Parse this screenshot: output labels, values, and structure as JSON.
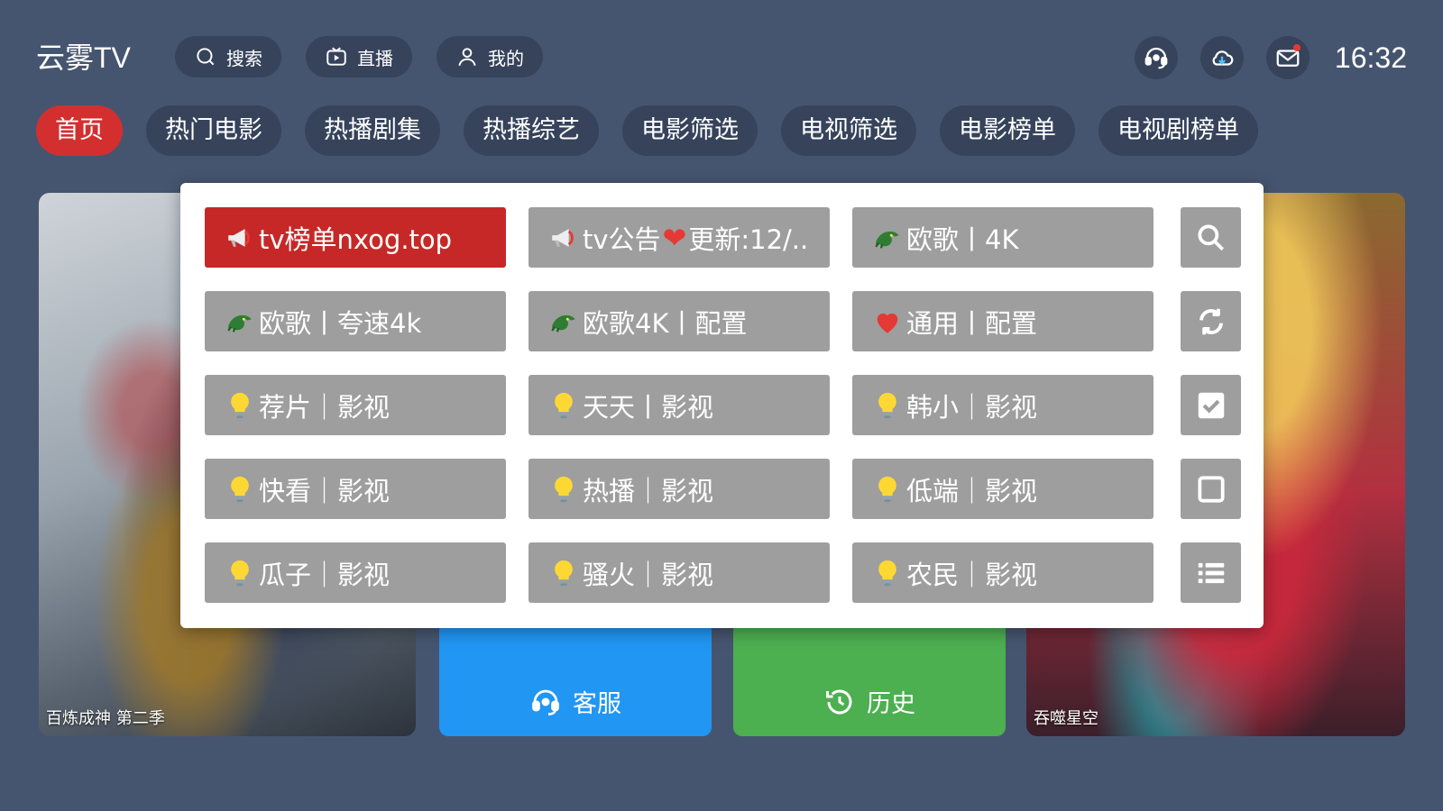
{
  "header": {
    "app_title": "云雾TV",
    "pills": [
      {
        "label": "搜索",
        "icon": "search-icon"
      },
      {
        "label": "直播",
        "icon": "live-tv-icon"
      },
      {
        "label": "我的",
        "icon": "user-icon"
      }
    ],
    "round_buttons": [
      "headset-icon",
      "cloud-icon",
      "mail-icon"
    ],
    "clock": "16:32"
  },
  "tabs": [
    "首页",
    "热门电影",
    "热播剧集",
    "热播综艺",
    "电影筛选",
    "电视筛选",
    "电影榜单",
    "电视剧榜单"
  ],
  "active_tab": "首页",
  "posters": {
    "left_caption": "百炼成神 第二季",
    "right_caption": "吞噬星空"
  },
  "actions": {
    "service_label": "客服",
    "history_label": "历史"
  },
  "source_panel": {
    "rows": [
      [
        {
          "label": "tv榜单nxog.top",
          "icon": "megaphone-icon",
          "active": true
        },
        {
          "label": "tv公告",
          "heart": "❤",
          "suffix": "更新:12/..",
          "icon": "megaphone-icon"
        },
        {
          "label": "欧歌丨4K",
          "icon": "dragon-icon"
        }
      ],
      [
        {
          "label": "欧歌丨夸速4k",
          "icon": "dragon-icon"
        },
        {
          "label": "欧歌4K丨配置",
          "icon": "dragon-icon"
        },
        {
          "label": "通用丨配置",
          "icon": "heart-icon"
        }
      ],
      [
        {
          "label": "荐片｜影视",
          "icon": "bulb-icon"
        },
        {
          "label": "天天丨影视",
          "icon": "bulb-icon"
        },
        {
          "label": "韩小｜影视",
          "icon": "bulb-icon"
        }
      ],
      [
        {
          "label": "快看｜影视",
          "icon": "bulb-icon"
        },
        {
          "label": "热播｜影视",
          "icon": "bulb-icon"
        },
        {
          "label": "低端｜影视",
          "icon": "bulb-icon"
        }
      ],
      [
        {
          "label": "瓜子｜影视",
          "icon": "bulb-icon"
        },
        {
          "label": "骚火｜影视",
          "icon": "bulb-icon"
        },
        {
          "label": "农民｜影视",
          "icon": "bulb-icon"
        }
      ]
    ],
    "side_buttons": [
      "search-icon",
      "refresh-icon",
      "checkbox-checked-icon",
      "checkbox-empty-icon",
      "list-icon"
    ]
  },
  "colors": {
    "background": "#46556f",
    "pill": "#36435b",
    "active_tab": "#d32f2f",
    "active_source": "#c62828",
    "source_button": "#9e9e9e",
    "service_tile": "#2196f3",
    "history_tile": "#4caf50"
  }
}
